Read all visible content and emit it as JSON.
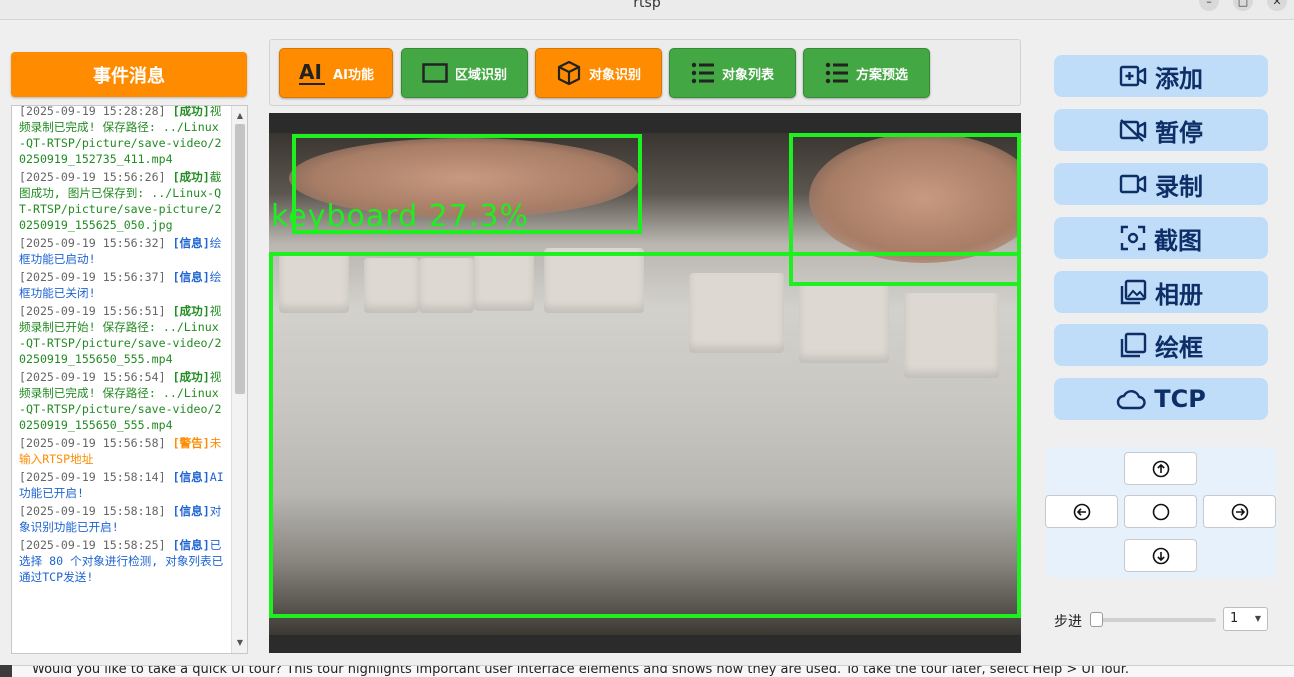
{
  "window": {
    "title": "rtsp"
  },
  "event_panel": {
    "header": "事件消息",
    "entries": [
      {
        "ts": "[2025-09-19 15:28:28]",
        "level": "[成功]",
        "type": "success",
        "msg": "视频录制已完成! 保存路径: ../Linux-QT-RTSP/picture/save-video/20250919_152735_411.mp4"
      },
      {
        "ts": "[2025-09-19 15:56:26]",
        "level": "[成功]",
        "type": "success",
        "msg": "截图成功, 图片已保存到: ../Linux-QT-RTSP/picture/save-picture/20250919_155625_050.jpg"
      },
      {
        "ts": "[2025-09-19 15:56:32]",
        "level": "[信息]",
        "type": "info",
        "msg": "绘框功能已启动!"
      },
      {
        "ts": "[2025-09-19 15:56:37]",
        "level": "[信息]",
        "type": "info",
        "msg": "绘框功能已关闭!"
      },
      {
        "ts": "[2025-09-19 15:56:51]",
        "level": "[成功]",
        "type": "success",
        "msg": "视频录制已开始! 保存路径: ../Linux-QT-RTSP/picture/save-video/20250919_155650_555.mp4"
      },
      {
        "ts": "[2025-09-19 15:56:54]",
        "level": "[成功]",
        "type": "success",
        "msg": "视频录制已完成! 保存路径: ../Linux-QT-RTSP/picture/save-video/20250919_155650_555.mp4"
      },
      {
        "ts": "[2025-09-19 15:56:58]",
        "level": "[警告]",
        "type": "warn",
        "msg": "未输入RTSP地址"
      },
      {
        "ts": "[2025-09-19 15:58:14]",
        "level": "[信息]",
        "type": "info",
        "msg": "AI功能已开启!"
      },
      {
        "ts": "[2025-09-19 15:58:18]",
        "level": "[信息]",
        "type": "info",
        "msg": "对象识别功能已开启!"
      },
      {
        "ts": "[2025-09-19 15:58:25]",
        "level": "[信息]",
        "type": "info",
        "msg": "已选择 80 个对象进行检测, 对象列表已通过TCP发送!"
      }
    ]
  },
  "toolbar": {
    "ai": "AI功能",
    "region": "区域识别",
    "object": "对象识别",
    "object_list": "对象列表",
    "preset": "方案预选"
  },
  "video": {
    "detection_label": "keyboard 27.3%"
  },
  "side_buttons": {
    "add": "添加",
    "pause": "暂停",
    "record": "录制",
    "screenshot": "截图",
    "album": "相册",
    "draw_box": "绘框",
    "tcp": "TCP"
  },
  "step": {
    "label": "步进",
    "value": "1",
    "slider_fraction": 0
  },
  "tour_banner": "Would you like to take a quick UI tour? This tour highlights important user interface elements and shows how they are used. To take the tour later, select Help > UI Tour.",
  "colors": {
    "orange": "#ff8c00",
    "green": "#43a843",
    "side_button_bg": "#bfdcf8",
    "side_button_text": "#0d2e66",
    "bbox": "#1eef1e"
  }
}
